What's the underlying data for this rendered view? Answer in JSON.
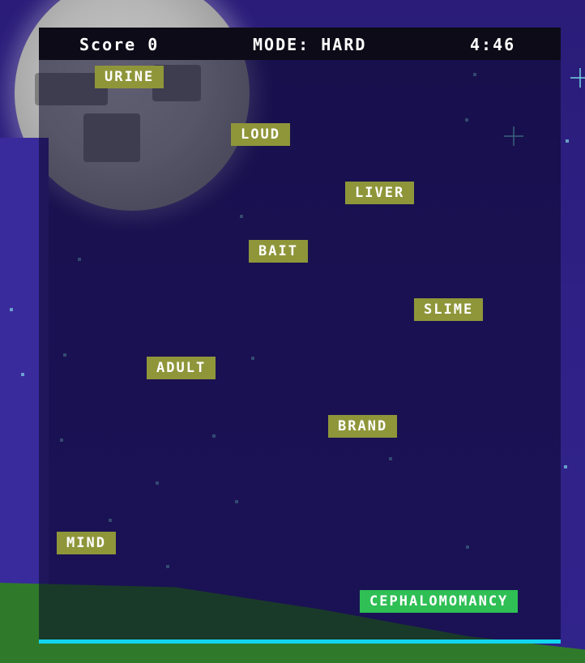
{
  "hud": {
    "score_label": "Score 0",
    "mode_label": "MODE: HARD",
    "timer": "4:46"
  },
  "words": {
    "urine": "URINE",
    "loud": "LOUD",
    "liver": "LIVER",
    "bait": "BAIT",
    "slime": "SLIME",
    "adult": "ADULT",
    "brand": "BRAND",
    "mind": "MIND",
    "typed": "CEPHALOMOMANCY"
  },
  "colors": {
    "word_bg": "#8f963a",
    "typed_word_bg": "#2fbf55",
    "hud_bg": "#0d0b17",
    "progress": "#12d6f0"
  },
  "progress": {
    "fraction": 1.0
  }
}
